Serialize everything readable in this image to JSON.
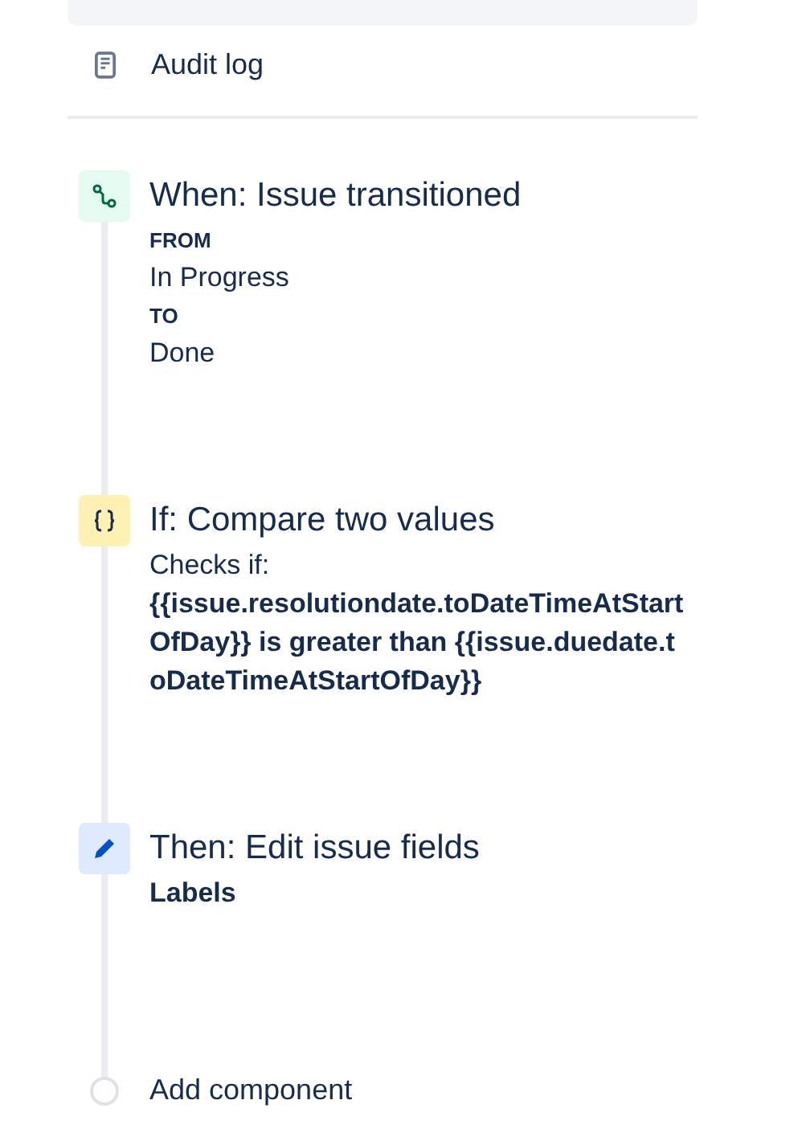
{
  "nav": {
    "items": [
      {
        "label": "Audit log"
      }
    ]
  },
  "steps": [
    {
      "kind": "trigger",
      "title": "When: Issue transitioned",
      "details": [
        {
          "kind": "heading",
          "text": "FROM"
        },
        {
          "kind": "value",
          "text": "In Progress"
        },
        {
          "kind": "heading",
          "text": "TO"
        },
        {
          "kind": "value",
          "text": "Done"
        }
      ]
    },
    {
      "kind": "condition",
      "title": "If: Compare two values",
      "details": [
        {
          "kind": "value",
          "text": "Checks if:"
        },
        {
          "kind": "expression",
          "text": "{{issue.resolutiondate.toDateTimeAtStartOfDay}} is greater than {{issue.duedate.toDateTimeAtStartOfDay}}"
        }
      ]
    },
    {
      "kind": "action",
      "title": "Then: Edit issue fields",
      "details": [
        {
          "kind": "expression",
          "text": "Labels"
        }
      ]
    }
  ],
  "add_component": {
    "label": "Add component"
  }
}
